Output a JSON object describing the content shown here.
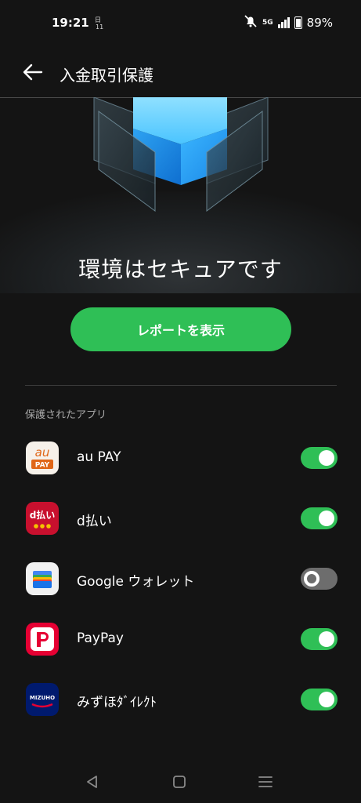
{
  "status_bar": {
    "time": "19:21",
    "notification_glyph": "⽇\n11",
    "network": "5G",
    "battery": "89%"
  },
  "header": {
    "title": "入金取引保護",
    "back_icon": "arrow-left-icon"
  },
  "security": {
    "status": "環境はセキュアです",
    "report_button": "レポートを表示"
  },
  "section": {
    "label": "保護されたアプリ"
  },
  "apps": [
    {
      "name": "au PAY",
      "icon": "au-pay-app-icon",
      "icon_text_top": "au",
      "icon_text_bottom": "PAY",
      "enabled": true
    },
    {
      "name": "d払い",
      "icon": "d-barai-app-icon",
      "icon_text": "d払い",
      "enabled": true
    },
    {
      "name": "Google ウォレット",
      "icon": "google-wallet-app-icon",
      "enabled": false
    },
    {
      "name": "PayPay",
      "icon": "paypay-app-icon",
      "enabled": true
    },
    {
      "name": "みずほﾀﾞｲﾚｸﾄ",
      "icon": "mizuho-app-icon",
      "icon_text": "MIZUHO",
      "enabled": true
    }
  ],
  "colors": {
    "background": "#141414",
    "accent_green": "#2fbf56",
    "toggle_off": "#6d6d6d"
  }
}
